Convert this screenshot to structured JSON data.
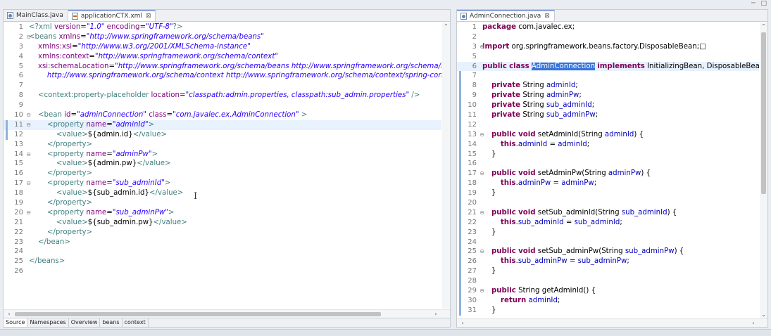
{
  "window_controls": [
    "─",
    "□"
  ],
  "left_editor": {
    "tabs": [
      {
        "label": "MainClass.java",
        "icon": "java-file-icon",
        "active": false
      },
      {
        "label": "applicationCTX.xml",
        "icon": "xml-file-icon",
        "active": true,
        "close": "⊠"
      }
    ],
    "bottom_tabs": [
      "Source",
      "Namespaces",
      "Overview",
      "beans",
      "context"
    ],
    "lines": [
      {
        "n": "1",
        "parts": [
          [
            "x-pi",
            "<?xml "
          ],
          [
            "x-attr",
            "version"
          ],
          [
            "",
            "="
          ],
          [
            "x-val",
            "\"1.0\""
          ],
          [
            "",
            " "
          ],
          [
            "x-attr",
            "encoding"
          ],
          [
            "",
            "="
          ],
          [
            "x-val",
            "\"UTF-8\""
          ],
          [
            "x-pi",
            "?>"
          ]
        ]
      },
      {
        "n": "2",
        "fold": true,
        "parts": [
          [
            "x-tag",
            "<beans "
          ],
          [
            "x-attr",
            "xmlns"
          ],
          [
            "",
            "="
          ],
          [
            "x-val",
            "\"http://www.springframework.org/schema/beans\""
          ]
        ]
      },
      {
        "n": "3",
        "parts": [
          [
            "",
            "    "
          ],
          [
            "x-attr",
            "xmlns:xsi"
          ],
          [
            "",
            "="
          ],
          [
            "x-val",
            "\"http://www.w3.org/2001/XMLSchema-instance\""
          ]
        ]
      },
      {
        "n": "4",
        "parts": [
          [
            "",
            "    "
          ],
          [
            "x-attr",
            "xmlns:context"
          ],
          [
            "",
            "="
          ],
          [
            "x-val",
            "\"http://www.springframework.org/schema/context\""
          ]
        ]
      },
      {
        "n": "5",
        "parts": [
          [
            "",
            "    "
          ],
          [
            "x-attr",
            "xsi:schemaLocation"
          ],
          [
            "",
            "="
          ],
          [
            "x-val",
            "\"http://www.springframework.org/schema/beans http://www.springframework.org/schema/beans"
          ]
        ]
      },
      {
        "n": "6",
        "parts": [
          [
            "",
            "        "
          ],
          [
            "x-val",
            "http://www.springframework.org/schema/context http://www.springframework.org/schema/context/spring-contex"
          ]
        ]
      },
      {
        "n": "7",
        "parts": []
      },
      {
        "n": "8",
        "parts": [
          [
            "",
            "    "
          ],
          [
            "x-tag",
            "<context:property-placeholder "
          ],
          [
            "x-attr",
            "location"
          ],
          [
            "",
            "="
          ],
          [
            "x-val",
            "\"classpath:admin.properties, classpath:sub_admin.properties\""
          ],
          [
            "x-tag",
            " />"
          ]
        ]
      },
      {
        "n": "9",
        "parts": []
      },
      {
        "n": "10",
        "fold": true,
        "parts": [
          [
            "",
            "    "
          ],
          [
            "x-tag",
            "<bean "
          ],
          [
            "x-attr",
            "id"
          ],
          [
            "",
            "="
          ],
          [
            "x-val",
            "\"adminConnection\""
          ],
          [
            "",
            " "
          ],
          [
            "x-attr",
            "class"
          ],
          [
            "",
            "="
          ],
          [
            "x-val",
            "\"com.javalec.ex.AdminConnection\""
          ],
          [
            "x-tag",
            " >"
          ]
        ]
      },
      {
        "n": "11",
        "fold": true,
        "hl": true,
        "mark": true,
        "parts": [
          [
            "",
            "        "
          ],
          [
            "x-tag",
            "<property "
          ],
          [
            "x-attr",
            "name"
          ],
          [
            "",
            "="
          ],
          [
            "x-val",
            "\"adminId\""
          ],
          [
            "x-tag",
            ">"
          ]
        ]
      },
      {
        "n": "12",
        "mark": true,
        "parts": [
          [
            "",
            "            "
          ],
          [
            "x-tag",
            "<value>"
          ],
          [
            "",
            "${admin.id}"
          ],
          [
            "x-tag",
            "</value>"
          ]
        ]
      },
      {
        "n": "13",
        "parts": [
          [
            "",
            "        "
          ],
          [
            "x-tag",
            "</property>"
          ]
        ]
      },
      {
        "n": "14",
        "fold": true,
        "parts": [
          [
            "",
            "        "
          ],
          [
            "x-tag",
            "<property "
          ],
          [
            "x-attr",
            "name"
          ],
          [
            "",
            "="
          ],
          [
            "x-val",
            "\"adminPw\""
          ],
          [
            "x-tag",
            ">"
          ]
        ]
      },
      {
        "n": "15",
        "parts": [
          [
            "",
            "            "
          ],
          [
            "x-tag",
            "<value>"
          ],
          [
            "",
            "${admin.pw}"
          ],
          [
            "x-tag",
            "</value>"
          ]
        ]
      },
      {
        "n": "16",
        "parts": [
          [
            "",
            "        "
          ],
          [
            "x-tag",
            "</property>"
          ]
        ]
      },
      {
        "n": "17",
        "fold": true,
        "parts": [
          [
            "",
            "        "
          ],
          [
            "x-tag",
            "<property "
          ],
          [
            "x-attr",
            "name"
          ],
          [
            "",
            "="
          ],
          [
            "x-val",
            "\"sub_adminId\""
          ],
          [
            "x-tag",
            ">"
          ]
        ]
      },
      {
        "n": "18",
        "parts": [
          [
            "",
            "            "
          ],
          [
            "x-tag",
            "<value>"
          ],
          [
            "",
            "${sub_admin.id}"
          ],
          [
            "x-tag",
            "</value>"
          ]
        ]
      },
      {
        "n": "19",
        "parts": [
          [
            "",
            "        "
          ],
          [
            "x-tag",
            "</property>"
          ]
        ]
      },
      {
        "n": "20",
        "fold": true,
        "parts": [
          [
            "",
            "        "
          ],
          [
            "x-tag",
            "<property "
          ],
          [
            "x-attr",
            "name"
          ],
          [
            "",
            "="
          ],
          [
            "x-val",
            "\"sub_adminPw\""
          ],
          [
            "x-tag",
            ">"
          ]
        ]
      },
      {
        "n": "21",
        "parts": [
          [
            "",
            "            "
          ],
          [
            "x-tag",
            "<value>"
          ],
          [
            "",
            "${sub_admin.pw}"
          ],
          [
            "x-tag",
            "</value>"
          ]
        ]
      },
      {
        "n": "22",
        "parts": [
          [
            "",
            "        "
          ],
          [
            "x-tag",
            "</property>"
          ]
        ]
      },
      {
        "n": "23",
        "parts": [
          [
            "",
            "    "
          ],
          [
            "x-tag",
            "</bean>"
          ]
        ]
      },
      {
        "n": "24",
        "parts": []
      },
      {
        "n": "25",
        "parts": [
          [
            "x-tag",
            "</beans>"
          ]
        ]
      },
      {
        "n": "26",
        "parts": []
      }
    ]
  },
  "right_editor": {
    "tabs": [
      {
        "label": "AdminConnection.java",
        "icon": "java-file-icon",
        "active": true,
        "close": "⊠"
      }
    ],
    "lines": [
      {
        "n": "1",
        "parts": [
          [
            "j-kw",
            "package"
          ],
          [
            "",
            " com.javalec.ex;"
          ]
        ]
      },
      {
        "n": "2",
        "parts": []
      },
      {
        "n": "3",
        "foldp": true,
        "parts": [
          [
            "j-kw",
            "import"
          ],
          [
            "",
            " org.springframework.beans.factory.DisposableBean;"
          ],
          [
            "",
            "□"
          ]
        ]
      },
      {
        "n": "5",
        "parts": []
      },
      {
        "n": "6",
        "hl": true,
        "parts": [
          [
            "j-kw",
            "public"
          ],
          [
            "",
            " "
          ],
          [
            "j-kw",
            "class"
          ],
          [
            "",
            " "
          ],
          [
            "j-sel",
            "AdminConnection"
          ],
          [
            "",
            " "
          ],
          [
            "j-kw",
            "implements"
          ],
          [
            "",
            " InitializingBean, DisposableBean {"
          ]
        ]
      },
      {
        "n": "7",
        "mark": true,
        "parts": []
      },
      {
        "n": "8",
        "mark": true,
        "parts": [
          [
            "",
            "    "
          ],
          [
            "j-kw",
            "private"
          ],
          [
            "",
            " String "
          ],
          [
            "j-fld",
            "adminId"
          ],
          [
            "",
            ";"
          ]
        ]
      },
      {
        "n": "9",
        "mark": true,
        "parts": [
          [
            "",
            "    "
          ],
          [
            "j-kw",
            "private"
          ],
          [
            "",
            " String "
          ],
          [
            "j-fld",
            "adminPw"
          ],
          [
            "",
            ";"
          ]
        ]
      },
      {
        "n": "10",
        "mark": true,
        "parts": [
          [
            "",
            "    "
          ],
          [
            "j-kw",
            "private"
          ],
          [
            "",
            " String "
          ],
          [
            "j-fld",
            "sub_adminId"
          ],
          [
            "",
            ";"
          ]
        ]
      },
      {
        "n": "11",
        "mark": true,
        "parts": [
          [
            "",
            "    "
          ],
          [
            "j-kw",
            "private"
          ],
          [
            "",
            " String "
          ],
          [
            "j-fld",
            "sub_adminPw"
          ],
          [
            "",
            ";"
          ]
        ]
      },
      {
        "n": "12",
        "mark": true,
        "parts": []
      },
      {
        "n": "13",
        "fold": true,
        "mark": true,
        "parts": [
          [
            "",
            "    "
          ],
          [
            "j-kw",
            "public"
          ],
          [
            "",
            " "
          ],
          [
            "j-kw",
            "void"
          ],
          [
            "",
            " setAdminId(String "
          ],
          [
            "j-fld",
            "adminId"
          ],
          [
            "",
            ") {"
          ]
        ]
      },
      {
        "n": "14",
        "mark": true,
        "parts": [
          [
            "",
            "        "
          ],
          [
            "j-kw",
            "this"
          ],
          [
            "",
            "."
          ],
          [
            "j-fld",
            "adminId"
          ],
          [
            "",
            " = "
          ],
          [
            "j-fld",
            "adminId"
          ],
          [
            "",
            ";"
          ]
        ]
      },
      {
        "n": "15",
        "mark": true,
        "parts": [
          [
            "",
            "    }"
          ]
        ]
      },
      {
        "n": "16",
        "mark": true,
        "parts": []
      },
      {
        "n": "17",
        "fold": true,
        "mark": true,
        "parts": [
          [
            "",
            "    "
          ],
          [
            "j-kw",
            "public"
          ],
          [
            "",
            " "
          ],
          [
            "j-kw",
            "void"
          ],
          [
            "",
            " setAdminPw(String "
          ],
          [
            "j-fld",
            "adminPw"
          ],
          [
            "",
            ") {"
          ]
        ]
      },
      {
        "n": "18",
        "mark": true,
        "parts": [
          [
            "",
            "        "
          ],
          [
            "j-kw",
            "this"
          ],
          [
            "",
            "."
          ],
          [
            "j-fld",
            "adminPw"
          ],
          [
            "",
            " = "
          ],
          [
            "j-fld",
            "adminPw"
          ],
          [
            "",
            ";"
          ]
        ]
      },
      {
        "n": "19",
        "mark": true,
        "parts": [
          [
            "",
            "    }"
          ]
        ]
      },
      {
        "n": "20",
        "mark": true,
        "parts": []
      },
      {
        "n": "21",
        "fold": true,
        "mark": true,
        "parts": [
          [
            "",
            "    "
          ],
          [
            "j-kw",
            "public"
          ],
          [
            "",
            " "
          ],
          [
            "j-kw",
            "void"
          ],
          [
            "",
            " setSub_adminId(String "
          ],
          [
            "j-fld",
            "sub_adminId"
          ],
          [
            "",
            ") {"
          ]
        ]
      },
      {
        "n": "22",
        "mark": true,
        "parts": [
          [
            "",
            "        "
          ],
          [
            "j-kw",
            "this"
          ],
          [
            "",
            "."
          ],
          [
            "j-fld",
            "sub_adminId"
          ],
          [
            "",
            " = "
          ],
          [
            "j-fld",
            "sub_adminId"
          ],
          [
            "",
            ";"
          ]
        ]
      },
      {
        "n": "23",
        "mark": true,
        "parts": [
          [
            "",
            "    }"
          ]
        ]
      },
      {
        "n": "24",
        "mark": true,
        "parts": []
      },
      {
        "n": "25",
        "fold": true,
        "mark": true,
        "parts": [
          [
            "",
            "    "
          ],
          [
            "j-kw",
            "public"
          ],
          [
            "",
            " "
          ],
          [
            "j-kw",
            "void"
          ],
          [
            "",
            " setSub_adminPw(String "
          ],
          [
            "j-fld",
            "sub_adminPw"
          ],
          [
            "",
            ") {"
          ]
        ]
      },
      {
        "n": "26",
        "mark": true,
        "parts": [
          [
            "",
            "        "
          ],
          [
            "j-kw",
            "this"
          ],
          [
            "",
            "."
          ],
          [
            "j-fld",
            "sub_adminPw"
          ],
          [
            "",
            " = "
          ],
          [
            "j-fld",
            "sub_adminPw"
          ],
          [
            "",
            ";"
          ]
        ]
      },
      {
        "n": "27",
        "mark": true,
        "parts": [
          [
            "",
            "    }"
          ]
        ]
      },
      {
        "n": "28",
        "mark": true,
        "parts": []
      },
      {
        "n": "29",
        "fold": true,
        "mark": true,
        "parts": [
          [
            "",
            "    "
          ],
          [
            "j-kw",
            "public"
          ],
          [
            "",
            " String getAdminId() {"
          ]
        ]
      },
      {
        "n": "30",
        "mark": true,
        "parts": [
          [
            "",
            "        "
          ],
          [
            "j-kw",
            "return"
          ],
          [
            "",
            " "
          ],
          [
            "j-fld",
            "adminId"
          ],
          [
            "",
            ";"
          ]
        ]
      },
      {
        "n": "31",
        "mark": true,
        "parts": [
          [
            "",
            "    }"
          ]
        ]
      }
    ]
  },
  "colors": {
    "xml_tag": "#3f7f7f",
    "xml_attr": "#7f007f",
    "xml_value": "#2a00ff",
    "java_keyword": "#7f0055",
    "java_field": "#0000c0",
    "selection": "#3874d8",
    "current_line": "#e8f2fe"
  }
}
